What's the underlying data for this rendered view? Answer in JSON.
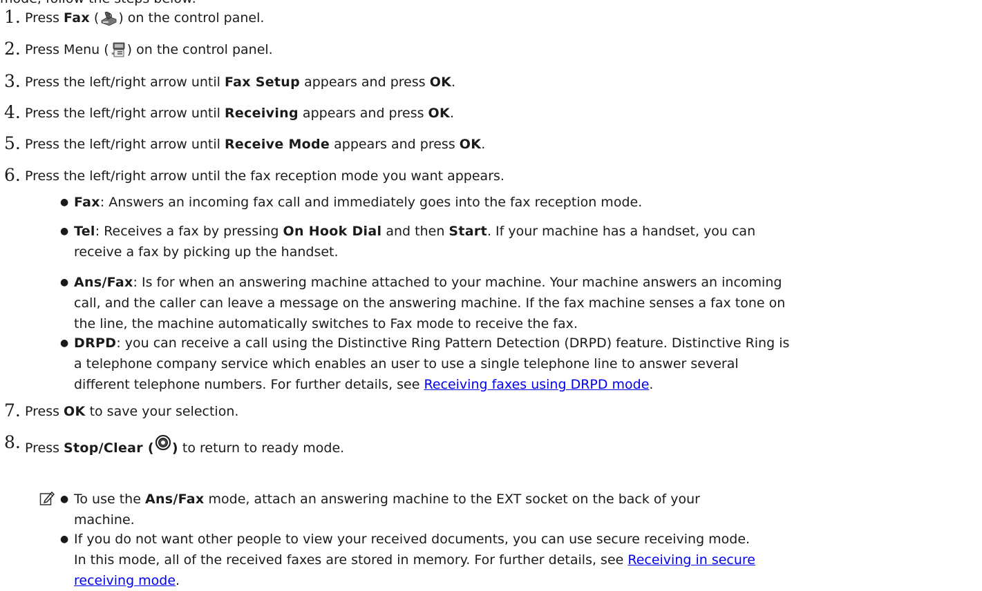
{
  "intro": "mode, follow the steps below:",
  "steps": [
    {
      "n": "1.",
      "pre": "Press ",
      "bold": "Fax",
      "post": " on the control panel."
    },
    {
      "n": "2.",
      "pre": "Press Menu (",
      "post": ") on the control panel."
    },
    {
      "n": "3.",
      "pre": "Press the left/right arrow until ",
      "bold": "Fax Setup",
      "mid": " appears and press ",
      "bold2": "OK",
      "post": "."
    },
    {
      "n": "4.",
      "pre": "Press the left/right arrow until ",
      "bold": "Receiving",
      "mid": " appears and press ",
      "bold2": "OK",
      "post": "."
    },
    {
      "n": "5.",
      "pre": "Press the left/right arrow until ",
      "bold": "Receive Mode",
      "mid": " appears and press ",
      "bold2": "OK",
      "post": "."
    },
    {
      "n": "6.",
      "text": "Press the left/right arrow until the fax reception mode you want appears."
    },
    {
      "n": "7.",
      "pre": "Press ",
      "bold": "OK",
      "post": " to save your selection."
    },
    {
      "n": "8.",
      "pre": "Press ",
      "bold": "Stop/Clear (",
      "bold_close": ")",
      "post": " to return to ready mode."
    }
  ],
  "modes": {
    "fax": {
      "term": "Fax",
      "sep": ":",
      "text": " Answers an incoming fax call and immediately goes into the fax reception mode."
    },
    "tel": {
      "term": "Tel",
      "sep": ":",
      "text1": " Receives a fax by pressing ",
      "b1": "On Hook Dial",
      "text2": " and then ",
      "b2": "Start",
      "text3": ". If your machine has a handset, you can",
      "line2": "receive a fax by picking up the handset."
    },
    "ansfax": {
      "term": "Ans/Fax",
      "sep": ":",
      "line1": " Is for when an answering machine attached to your machine. Your machine answers an incoming",
      "line2": "call, and the caller can leave a message on the answering machine. If the fax machine senses a fax tone on",
      "line3": "the line, the machine automatically switches to Fax mode to receive the fax."
    },
    "drpd": {
      "term": "DRPD",
      "sep": ":",
      "line1": " you can receive a call using the Distinctive Ring Pattern Detection (DRPD) feature. Distinctive Ring is",
      "line2": "a telephone company service which enables an user to use a single telephone line to answer several",
      "line3": "different telephone numbers. For further details, see ",
      "link": "Receiving faxes using DRPD mode",
      "end": "."
    }
  },
  "notes": {
    "n1_pre": "To use the ",
    "n1_bold": "Ans/Fax",
    "n1_post": " mode, attach an answering machine to the EXT socket on the back of your",
    "n1_line2": "machine.",
    "n2_line1": "If you do not want other people to view your received documents, you can use secure receiving mode.",
    "n2_line2": "In this mode, all of the received faxes are stored in memory. For further details, see ",
    "n2_link_a": "Receiving in secure",
    "n2_link_b": "receiving mode",
    "n2_end": "."
  },
  "icons": {
    "fax": "fax-machine-icon",
    "menu": "menu-icon",
    "stop": "stop-clear-icon",
    "note": "note-pencil-icon"
  },
  "colors": {
    "link": "#0000ee",
    "text": "#1a1a1a"
  }
}
